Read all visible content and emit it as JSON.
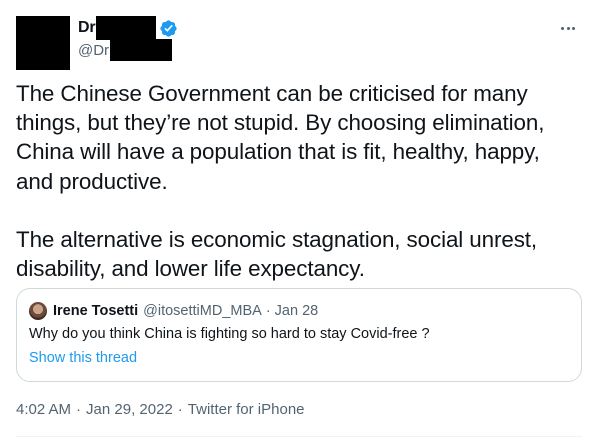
{
  "author": {
    "name_visible": "Dr",
    "handle_visible": "@Dr",
    "verified_icon": "verified-badge-icon",
    "more_icon": "more-options-icon"
  },
  "tweet": {
    "text": "The Chinese Government can be criticised for many things, but they’re not stupid. By choosing elimination, China will have a population that is fit, healthy, happy, and productive.\n\nThe alternative is economic stagnation, social unrest, disability, and lower life expectancy."
  },
  "quote": {
    "name": "Irene Tosetti",
    "handle": "@itosettiMD_MBA",
    "separator": "·",
    "date": "Jan 28",
    "text": "Why do you think China is fighting so hard to stay Covid-free ?",
    "show_thread": "Show this thread"
  },
  "meta": {
    "time": "4:02 AM",
    "separator": "·",
    "date": "Jan 29, 2022",
    "separator2": "·",
    "source": "Twitter for iPhone"
  },
  "colors": {
    "text": "#0f1419",
    "secondary": "#536471",
    "accent": "#1d9bf0",
    "border": "#cfd9de"
  }
}
